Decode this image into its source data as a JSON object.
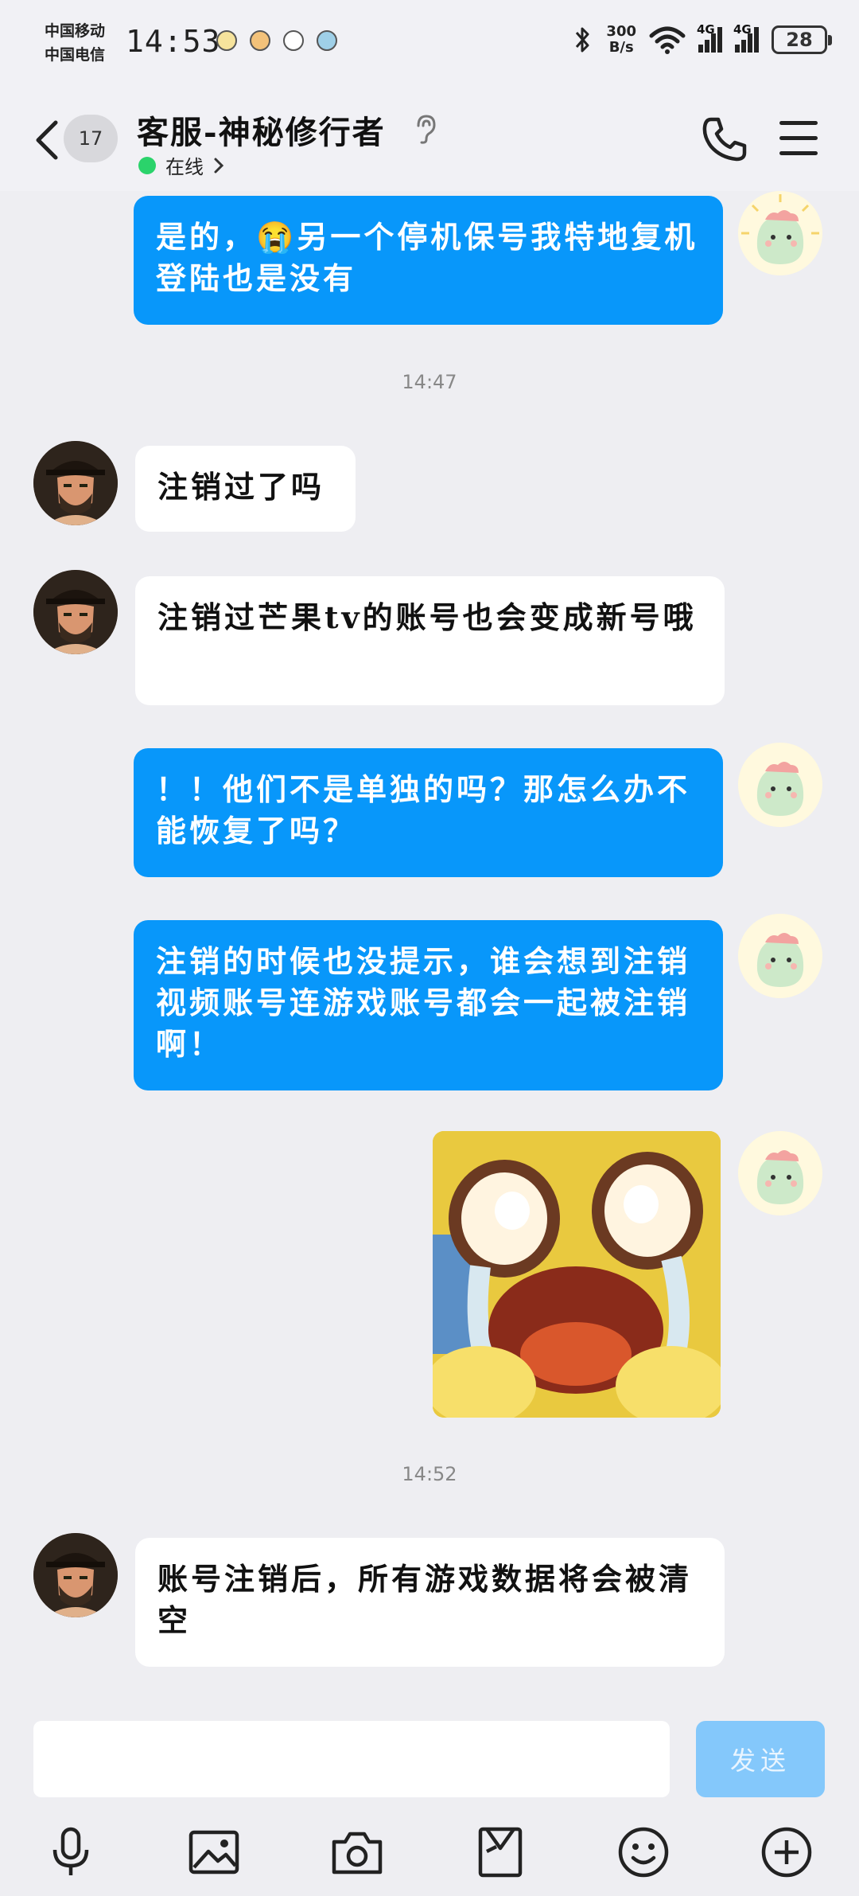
{
  "status_bar": {
    "carrier_1": "中国移动",
    "carrier_2": "中国电信",
    "time": "14:53",
    "net_speed_value": "300",
    "net_speed_unit": "B/s",
    "network_1": "4G",
    "network_2": "4G",
    "battery": "28"
  },
  "header": {
    "unread_count": "17",
    "title": "客服-神秘修行者",
    "presence": "在线",
    "presence_color": "#2bd36b"
  },
  "messages": [
    {
      "from": "me",
      "text": "是的，😭另一个停机保号我特地复机登陆也是没有"
    },
    {
      "type": "time",
      "text": "14:47"
    },
    {
      "from": "other",
      "text": "注销过了吗"
    },
    {
      "from": "other",
      "text": "注销过芒果tv的账号也会变成新号哦"
    },
    {
      "from": "me",
      "text": "！！他们不是单独的吗？那怎么办不能恢复了吗？"
    },
    {
      "from": "me",
      "text": "注销的时候也没提示，谁会想到注销视频账号连游戏账号都会一起被注销啊！"
    },
    {
      "from": "me",
      "type": "sticker",
      "text": "crying-face-sticker"
    },
    {
      "type": "time",
      "text": "14:52"
    },
    {
      "from": "other",
      "text": "账号注销后，所有游戏数据将会被清空"
    }
  ],
  "composer": {
    "input_value": "",
    "send_label": "发送"
  },
  "colors": {
    "my_bubble": "#0897fa",
    "other_bubble": "#ffffff",
    "send_button": "#84c8fb",
    "background": "#eeeef2"
  },
  "toolbar_icons": [
    "microphone-icon",
    "image-icon",
    "camera-icon",
    "file-icon",
    "emoji-icon",
    "plus-icon"
  ]
}
